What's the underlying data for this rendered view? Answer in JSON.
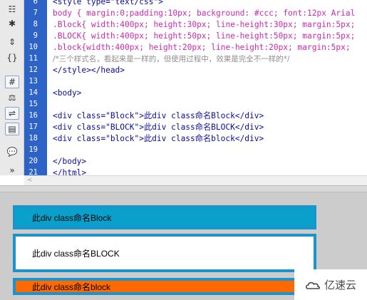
{
  "toolbar": {
    "icons": [
      "table-icon",
      "asterisk-icon",
      "collapse-icon",
      "braces-icon",
      "highlight-icon",
      "balance-icon",
      "wrap-icon",
      "select-icon",
      "comment-icon",
      "more-icon"
    ],
    "glyphs": [
      "☷",
      "✱",
      "⇕",
      "{}",
      "#",
      "⚖",
      "⇌",
      "▤",
      "💬",
      "»"
    ]
  },
  "editor": {
    "lines": [
      {
        "num": "6",
        "text": "<style type=\"text/css\">",
        "kind": "tag"
      },
      {
        "num": "7",
        "text": "body { margin:0;padding:10px; background: #ccc; font:12px Arial",
        "kind": "css"
      },
      {
        "num": "8",
        "text": ".Block{ width:400px; height:30px; line-height:30px; margin:5px;",
        "kind": "css"
      },
      {
        "num": "9",
        "text": ".BLOCK{ width:400px; height:50px; line-height:50px; margin:5px;",
        "kind": "css"
      },
      {
        "num": "10",
        "text": ".block{width:400px; height:20px; line-height:20px; margin:5px;",
        "kind": "css"
      },
      {
        "num": "11",
        "text": "/*三个样式名，看起来是一样的，但使用过程中，效果是完全不一样的*/",
        "kind": "comment"
      },
      {
        "num": "12",
        "text": "</style></head>",
        "kind": "tag"
      },
      {
        "num": "13",
        "text": "",
        "kind": "tag"
      },
      {
        "num": "14",
        "text": "<body>",
        "kind": "tag"
      },
      {
        "num": "15",
        "text": "",
        "kind": "tag"
      },
      {
        "num": "16",
        "text": "<div class=\"Block\">此div class命名Block</div>",
        "kind": "tag"
      },
      {
        "num": "17",
        "text": "<div class=\"BLOCK\">此div class命名BLOCK</div>",
        "kind": "tag"
      },
      {
        "num": "18",
        "text": "<div class=\"block\">此div class命名block</div>",
        "kind": "tag"
      },
      {
        "num": "19",
        "text": "",
        "kind": "tag"
      },
      {
        "num": "20",
        "text": "</body>",
        "kind": "tag"
      },
      {
        "num": "21",
        "text": "</html>",
        "kind": "tag"
      }
    ]
  },
  "preview": {
    "box1": "此div class命名Block",
    "box2": "此div class命名BLOCK",
    "box3": "此div class命名block"
  },
  "watermark": {
    "text": "亿速云"
  },
  "colors": {
    "gutter": "#2d62c7",
    "box1": "#0aa0cc",
    "box3": "#ff6a00",
    "border": "#1b93cb",
    "background": "#cccccc"
  }
}
